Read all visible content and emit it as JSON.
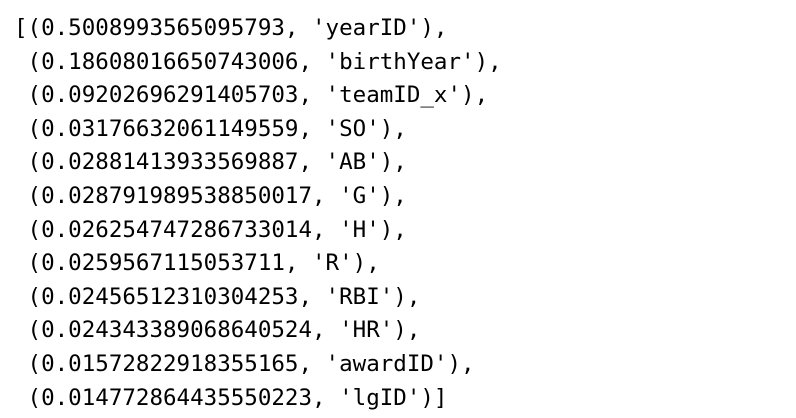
{
  "output": {
    "lines": [
      "[(0.5008993565095793, 'yearID'),",
      " (0.18608016650743006, 'birthYear'),",
      " (0.09202696291405703, 'teamID_x'),",
      " (0.03176632061149559, 'SO'),",
      " (0.02881413933569887, 'AB'),",
      " (0.028791989538850017, 'G'),",
      " (0.026254747286733014, 'H'),",
      " (0.0259567115053711, 'R'),",
      " (0.02456512310304253, 'RBI'),",
      " (0.024343389068640524, 'HR'),",
      " (0.01572822918355165, 'awardID'),",
      " (0.014772864435550223, 'lgID')]"
    ]
  }
}
